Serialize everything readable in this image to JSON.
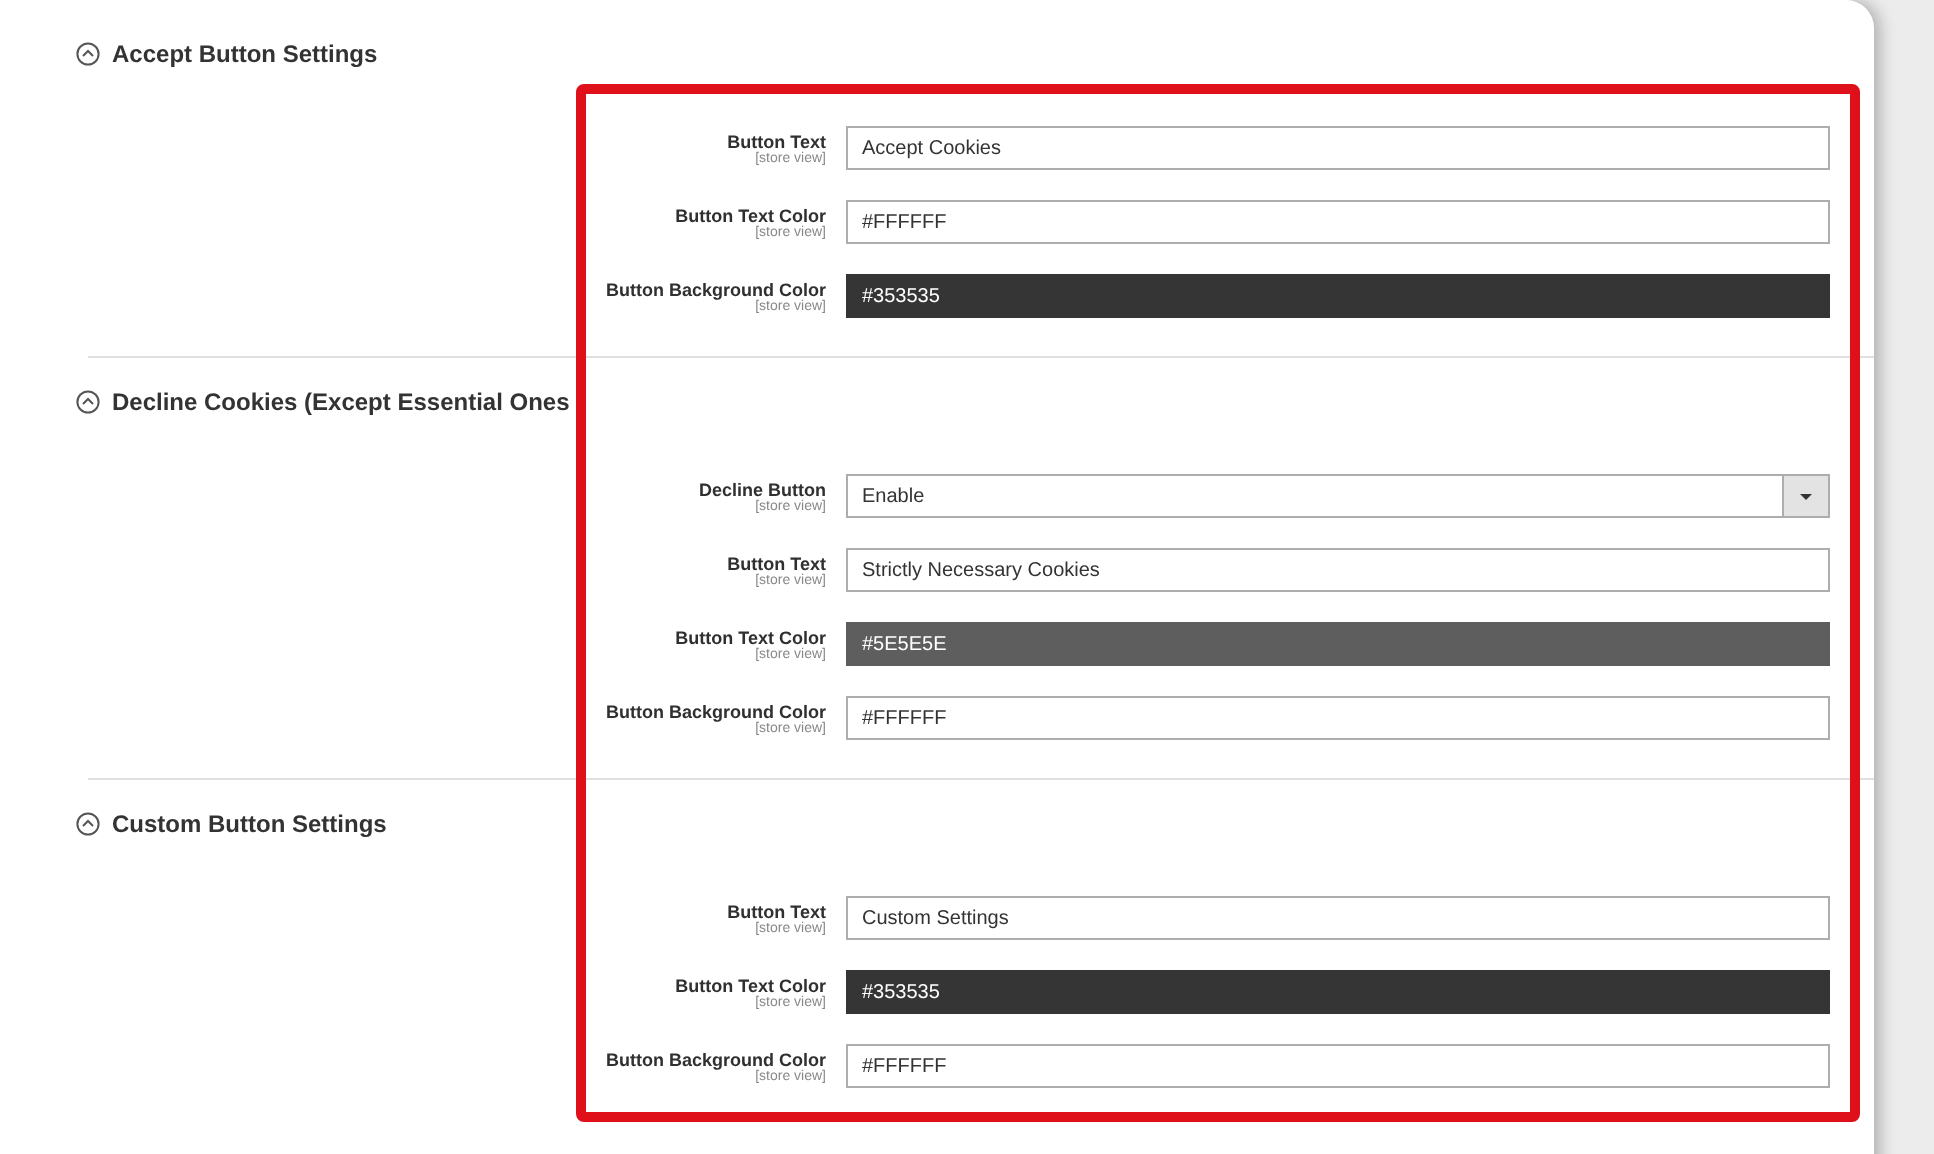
{
  "sections": [
    {
      "title": "Accept Button Settings",
      "expanded": true,
      "fields": [
        {
          "kind": "text",
          "label": "Button Text",
          "scope": "[store view]",
          "value": "Accept Cookies"
        },
        {
          "kind": "color",
          "label": "Button Text Color",
          "scope": "[store view]",
          "value": "#FFFFFF",
          "color": "#ffffff"
        },
        {
          "kind": "color",
          "label": "Button Background Color",
          "scope": "[store view]",
          "value": "#353535",
          "color": "#353535"
        }
      ]
    },
    {
      "title": "Decline Cookies (Except Essential Ones",
      "expanded": true,
      "fields": [
        {
          "kind": "select",
          "label": "Decline Button",
          "scope": "[store view]",
          "value": "Enable"
        },
        {
          "kind": "text",
          "label": "Button Text",
          "scope": "[store view]",
          "value": "Strictly Necessary Cookies"
        },
        {
          "kind": "color",
          "label": "Button Text Color",
          "scope": "[store view]",
          "value": "#5E5E5E",
          "color": "#5e5e5e"
        },
        {
          "kind": "color",
          "label": "Button Background Color",
          "scope": "[store view]",
          "value": "#FFFFFF",
          "color": "#ffffff"
        }
      ]
    },
    {
      "title": "Custom Button Settings",
      "expanded": true,
      "fields": [
        {
          "kind": "text",
          "label": "Button Text",
          "scope": "[store view]",
          "value": "Custom Settings"
        },
        {
          "kind": "color",
          "label": "Button Text Color",
          "scope": "[store view]",
          "value": "#353535",
          "color": "#353535"
        },
        {
          "kind": "color",
          "label": "Button Background Color",
          "scope": "[store view]",
          "value": "#FFFFFF",
          "color": "#ffffff"
        }
      ]
    }
  ]
}
